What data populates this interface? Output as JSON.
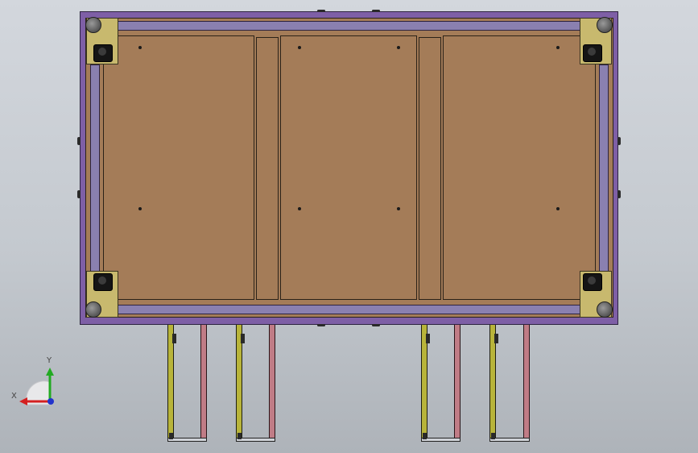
{
  "view": {
    "title": "",
    "background_colors": [
      "#d3d7dd",
      "#aeb3b9"
    ]
  },
  "colors": {
    "frame": "#7e5fa6",
    "rail": "#8a80b0",
    "panel": "#a47c58",
    "corner_plate": "#c8b96e",
    "leg_left": "#b8b43a",
    "leg_right": "#c07c86"
  },
  "triad": {
    "x_label": "X",
    "y_label": "Y",
    "x_color": "#d42020",
    "y_color": "#22aa22",
    "z_color": "#2233cc"
  }
}
